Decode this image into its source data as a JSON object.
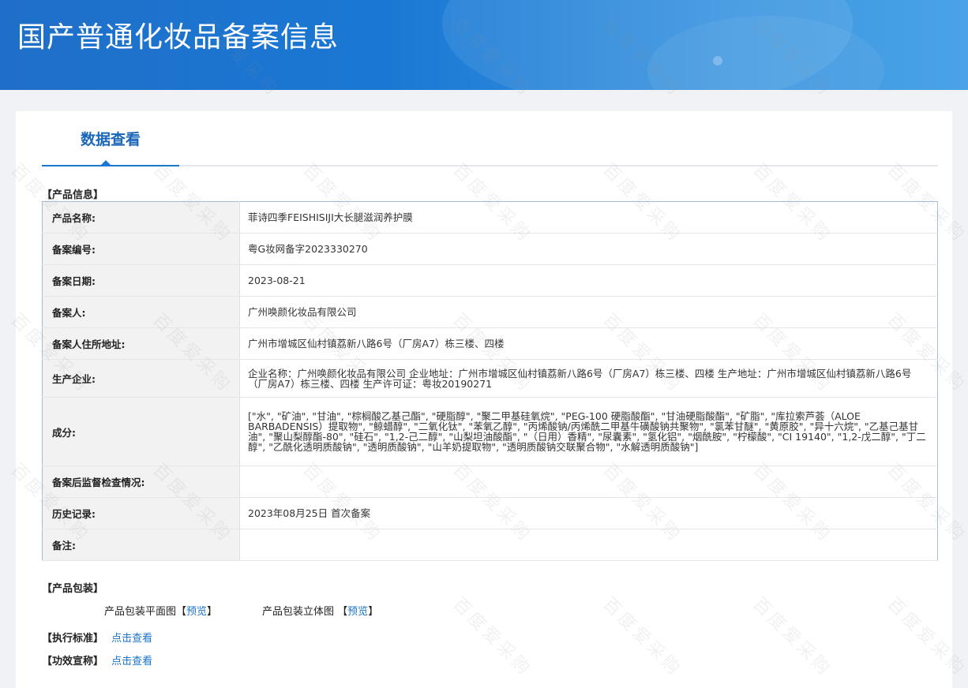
{
  "header": {
    "title": "国产普通化妆品备案信息"
  },
  "tabs": [
    {
      "label": "数据查看"
    }
  ],
  "product_info": {
    "section_title": "【产品信息】",
    "rows": [
      {
        "label": "产品名称:",
        "value": "菲诗四季FEISHISIJI大长腿滋润养护膜"
      },
      {
        "label": "备案编号:",
        "value": "粤G妆网备字2023330270"
      },
      {
        "label": "备案日期:",
        "value": "2023-08-21"
      },
      {
        "label": "备案人:",
        "value": "广州唤颜化妆品有限公司"
      },
      {
        "label": "备案人住所地址:",
        "value": "广州市增城区仙村镇荔新八路6号（厂房A7）栋三楼、四楼"
      },
      {
        "label": "生产企业:",
        "value": "企业名称：广州唤颜化妆品有限公司 企业地址：广州市增城区仙村镇荔新八路6号（厂房A7）栋三楼、四楼 生产地址：广州市增城区仙村镇荔新八路6号（厂房A7）栋三楼、四楼 生产许可证：粤妆20190271"
      },
      {
        "label": "成分:",
        "value": "[\"水\", \"矿油\", \"甘油\", \"棕榈酸乙基己酯\", \"硬脂醇\", \"聚二甲基硅氧烷\", \"PEG-100 硬脂酸酯\", \"甘油硬脂酸酯\", \"矿脂\", \"库拉索芦荟（ALOE BARBADENSIS）提取物\", \"鲸蜡醇\", \"二氧化钛\", \"苯氧乙醇\", \"丙烯酸钠/丙烯酰二甲基牛磺酸钠共聚物\", \"氯苯甘醚\", \"黄原胶\", \"异十六烷\", \"乙基己基甘油\", \"聚山梨醇酯-80\", \"硅石\", \"1,2-己二醇\", \"山梨坦油酸酯\", \"（日用）香精\", \"尿囊素\", \"氢化铝\", \"烟酰胺\", \"柠檬酸\", \"CI 19140\", \"1,2-戊二醇\", \"丁二醇\", \"乙酰化透明质酸钠\", \"透明质酸钠\", \"山羊奶提取物\", \"透明质酸钠交联聚合物\", \"水解透明质酸钠\"]"
      },
      {
        "label": "备案后监督检查情况:",
        "value": ""
      },
      {
        "label": "历史记录:",
        "value": "2023年08月25日 首次备案"
      },
      {
        "label": "备注:",
        "value": ""
      }
    ]
  },
  "packaging": {
    "section_title": "【产品包装】",
    "flat_label": "产品包装平面图",
    "three_d_label": "产品包装立体图",
    "preview_label": "预览",
    "bracket_open": "【",
    "bracket_close": "】"
  },
  "standard": {
    "label": "【执行标准】",
    "link": "点击查看"
  },
  "efficacy": {
    "label": "【功效宣称】",
    "link": "点击查看"
  },
  "watermark": {
    "text": "百度爱采购"
  }
}
